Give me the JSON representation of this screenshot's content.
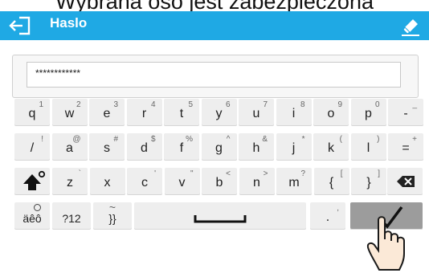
{
  "caption": "Wybrana oso jest zabezpieczona",
  "header": {
    "title": "Haslo",
    "back_icon": "exit-login-icon",
    "clear_icon": "eraser-icon",
    "accent": "#1fa9e4"
  },
  "password": {
    "value": "************"
  },
  "keyboard": {
    "rows": [
      [
        {
          "main": "q",
          "sub": "1"
        },
        {
          "main": "w",
          "sub": "2"
        },
        {
          "main": "e",
          "sub": "3"
        },
        {
          "main": "r",
          "sub": "4"
        },
        {
          "main": "t",
          "sub": "5"
        },
        {
          "main": "y",
          "sub": "6"
        },
        {
          "main": "u",
          "sub": "7"
        },
        {
          "main": "i",
          "sub": "8"
        },
        {
          "main": "o",
          "sub": "9"
        },
        {
          "main": "p",
          "sub": "0"
        },
        {
          "main": "-",
          "sub": "_"
        }
      ],
      [
        {
          "main": "/",
          "sub": "!"
        },
        {
          "main": "a",
          "sub": "@"
        },
        {
          "main": "s",
          "sub": "#"
        },
        {
          "main": "d",
          "sub": "$"
        },
        {
          "main": "f",
          "sub": "%"
        },
        {
          "main": "g",
          "sub": "^"
        },
        {
          "main": "h",
          "sub": "&"
        },
        {
          "main": "j",
          "sub": "*"
        },
        {
          "main": "k",
          "sub": "("
        },
        {
          "main": "l",
          "sub": ")"
        },
        {
          "main": "=",
          "sub": "+"
        }
      ],
      [
        {
          "main": "z",
          "sub": "`"
        },
        {
          "main": "x",
          "sub": ""
        },
        {
          "main": "c",
          "sub": "'"
        },
        {
          "main": "v",
          "sub": "\""
        },
        {
          "main": "b",
          "sub": "<"
        },
        {
          "main": "n",
          "sub": ">"
        },
        {
          "main": "m",
          "sub": "?"
        },
        {
          "main": "{",
          "sub": "["
        },
        {
          "main": "}",
          "sub": "]"
        }
      ]
    ],
    "shift_icon": "shift-arrow-icon",
    "backspace_icon": "backspace-icon",
    "accent_label": "äêô",
    "numbers_label": "?12",
    "symbols_label": "}}",
    "symbols_sub": "~",
    "space_icon": "spacebar-icon",
    "dot_main": ".",
    "dot_sub": ",",
    "accept_icon": "checkmark-icon"
  },
  "cursor_icon": "pointing-hand-icon"
}
